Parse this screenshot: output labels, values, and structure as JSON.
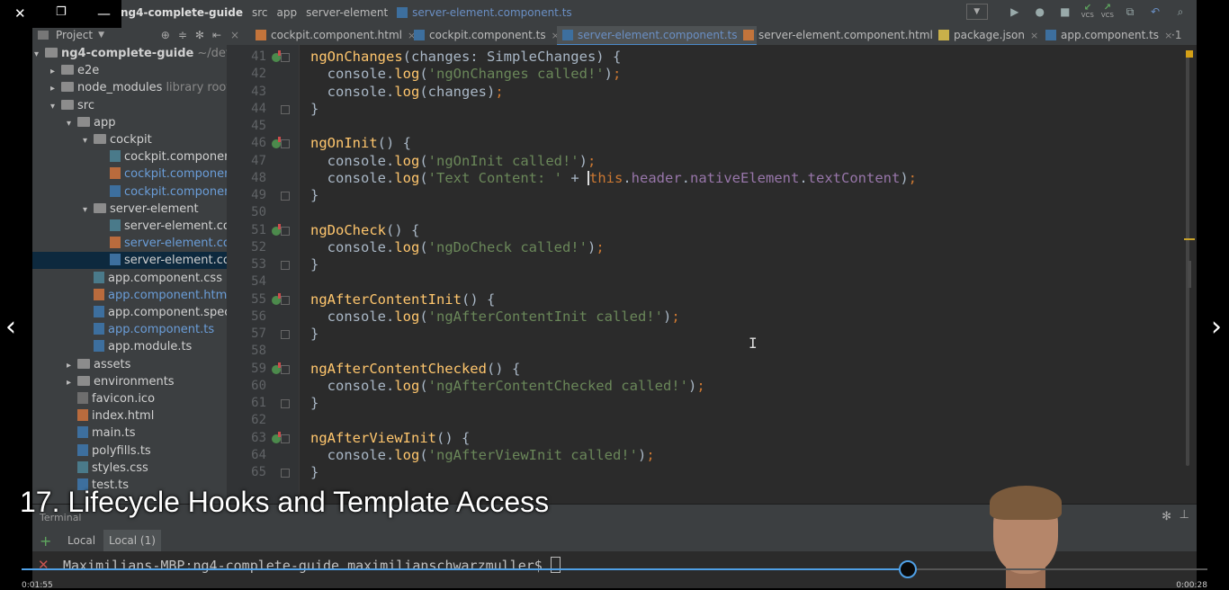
{
  "breadcrumbs": [
    "ng4-complete-guide",
    "src",
    "app",
    "server-element",
    "server-element.component.ts"
  ],
  "project_header": "Project",
  "tabs": [
    {
      "label": "cockpit.component.html",
      "type": "html"
    },
    {
      "label": "cockpit.component.ts",
      "type": "ts"
    },
    {
      "label": "server-element.component.ts",
      "type": "ts",
      "active": true
    },
    {
      "label": "server-element.component.html",
      "type": "html"
    },
    {
      "label": "package.json",
      "type": "json"
    },
    {
      "label": "app.component.ts",
      "type": "ts"
    }
  ],
  "tabs_more": "·1",
  "tree": {
    "root_name": "ng4-complete-guide",
    "root_path": "~/develop",
    "items": [
      {
        "label": "e2e",
        "indent": 1,
        "kind": "folder",
        "arrow": "▸"
      },
      {
        "label": "node_modules",
        "suffix": "library root",
        "indent": 1,
        "kind": "folder",
        "arrow": "▸"
      },
      {
        "label": "src",
        "indent": 1,
        "kind": "folder",
        "arrow": "▾"
      },
      {
        "label": "app",
        "indent": 2,
        "kind": "folder",
        "arrow": "▾"
      },
      {
        "label": "cockpit",
        "indent": 3,
        "kind": "folder",
        "arrow": "▾"
      },
      {
        "label": "cockpit.component.",
        "indent": 4,
        "kind": "css"
      },
      {
        "label": "cockpit.component.",
        "indent": 4,
        "kind": "html",
        "blue": true
      },
      {
        "label": "cockpit.component.",
        "indent": 4,
        "kind": "ts",
        "blue": true
      },
      {
        "label": "server-element",
        "indent": 3,
        "kind": "folder",
        "arrow": "▾"
      },
      {
        "label": "server-element.com",
        "indent": 4,
        "kind": "css"
      },
      {
        "label": "server-element.com",
        "indent": 4,
        "kind": "html",
        "blue": true
      },
      {
        "label": "server-element.com",
        "indent": 4,
        "kind": "ts",
        "selected": true
      },
      {
        "label": "app.component.css",
        "indent": 3,
        "kind": "css"
      },
      {
        "label": "app.component.html",
        "indent": 3,
        "kind": "html",
        "blue": true
      },
      {
        "label": "app.component.spec.ts",
        "indent": 3,
        "kind": "ts"
      },
      {
        "label": "app.component.ts",
        "indent": 3,
        "kind": "ts",
        "blue": true
      },
      {
        "label": "app.module.ts",
        "indent": 3,
        "kind": "ts"
      },
      {
        "label": "assets",
        "indent": 2,
        "kind": "folder",
        "arrow": "▸"
      },
      {
        "label": "environments",
        "indent": 2,
        "kind": "folder",
        "arrow": "▸"
      },
      {
        "label": "favicon.ico",
        "indent": 2,
        "kind": "ico"
      },
      {
        "label": "index.html",
        "indent": 2,
        "kind": "html"
      },
      {
        "label": "main.ts",
        "indent": 2,
        "kind": "ts"
      },
      {
        "label": "polyfills.ts",
        "indent": 2,
        "kind": "ts"
      },
      {
        "label": "styles.css",
        "indent": 2,
        "kind": "css"
      },
      {
        "label": "test.ts",
        "indent": 2,
        "kind": "ts"
      }
    ]
  },
  "code_lines": [
    {
      "n": "41",
      "marker": true,
      "fold": true,
      "html": "<span class='fn'>ngOnChanges</span>(changes: SimpleChanges) {"
    },
    {
      "n": "42",
      "html": "  console.<span class='fn'>log</span>(<span class='str'>'ngOnChanges called!'</span>)<span class='punc'>;</span>"
    },
    {
      "n": "43",
      "html": "  console.<span class='fn'>log</span>(changes)<span class='punc'>;</span>"
    },
    {
      "n": "44",
      "fold": true,
      "html": "}"
    },
    {
      "n": "45",
      "html": ""
    },
    {
      "n": "46",
      "marker": true,
      "fold": true,
      "html": "<span class='fn'>ngOnInit</span>() {"
    },
    {
      "n": "47",
      "html": "  console.<span class='fn'>log</span>(<span class='str'>'ngOnInit called!'</span>)<span class='punc'>;</span>"
    },
    {
      "n": "48",
      "html": "  console.<span class='fn'>log</span>(<span class='str'>'Text Content: '</span> + <span class='caret'></span><span class='kw'>this</span>.<span class='prop'>header</span>.<span class='prop'>nativeElement</span>.<span class='prop'>textContent</span>)<span class='punc'>;</span>"
    },
    {
      "n": "49",
      "fold": true,
      "html": "}"
    },
    {
      "n": "50",
      "html": ""
    },
    {
      "n": "51",
      "marker": true,
      "fold": true,
      "html": "<span class='fn'>ngDoCheck</span>() {"
    },
    {
      "n": "52",
      "html": "  console.<span class='fn'>log</span>(<span class='str'>'ngDoCheck called!'</span>)<span class='punc'>;</span>"
    },
    {
      "n": "53",
      "fold": true,
      "html": "}"
    },
    {
      "n": "54",
      "html": ""
    },
    {
      "n": "55",
      "marker": true,
      "fold": true,
      "html": "<span class='fn'>ngAfterContentInit</span>() {"
    },
    {
      "n": "56",
      "html": "  console.<span class='fn'>log</span>(<span class='str'>'ngAfterContentInit called!'</span>)<span class='punc'>;</span>"
    },
    {
      "n": "57",
      "fold": true,
      "html": "}"
    },
    {
      "n": "58",
      "html": ""
    },
    {
      "n": "59",
      "marker": true,
      "fold": true,
      "html": "<span class='fn'>ngAfterContentChecked</span>() {"
    },
    {
      "n": "60",
      "html": "  console.<span class='fn'>log</span>(<span class='str'>'ngAfterContentChecked called!'</span>)<span class='punc'>;</span>"
    },
    {
      "n": "61",
      "fold": true,
      "html": "}"
    },
    {
      "n": "62",
      "html": ""
    },
    {
      "n": "63",
      "marker": true,
      "fold": true,
      "html": "<span class='fn'>ngAfterViewInit</span>() {"
    },
    {
      "n": "64",
      "html": "  console.<span class='fn'>log</span>(<span class='str'>'ngAfterViewInit called!'</span>)<span class='punc'>;</span>"
    },
    {
      "n": "65",
      "fold": true,
      "html": "}"
    }
  ],
  "terminal": {
    "header": "Terminal",
    "tabs": [
      "Local",
      "Local (1)"
    ],
    "prompt": "Maximilians-MBP:ng4-complete-guide maximilianschwarzmuller$ "
  },
  "video": {
    "title": "17. Lifecycle Hooks and Template Access",
    "elapsed": "0:01:55",
    "remaining": "0:00:28",
    "progress": 0.747
  },
  "colors": {
    "accent": "#4fa0e6",
    "editor_bg": "#2b2b2b",
    "panel_bg": "#3c3f41"
  }
}
